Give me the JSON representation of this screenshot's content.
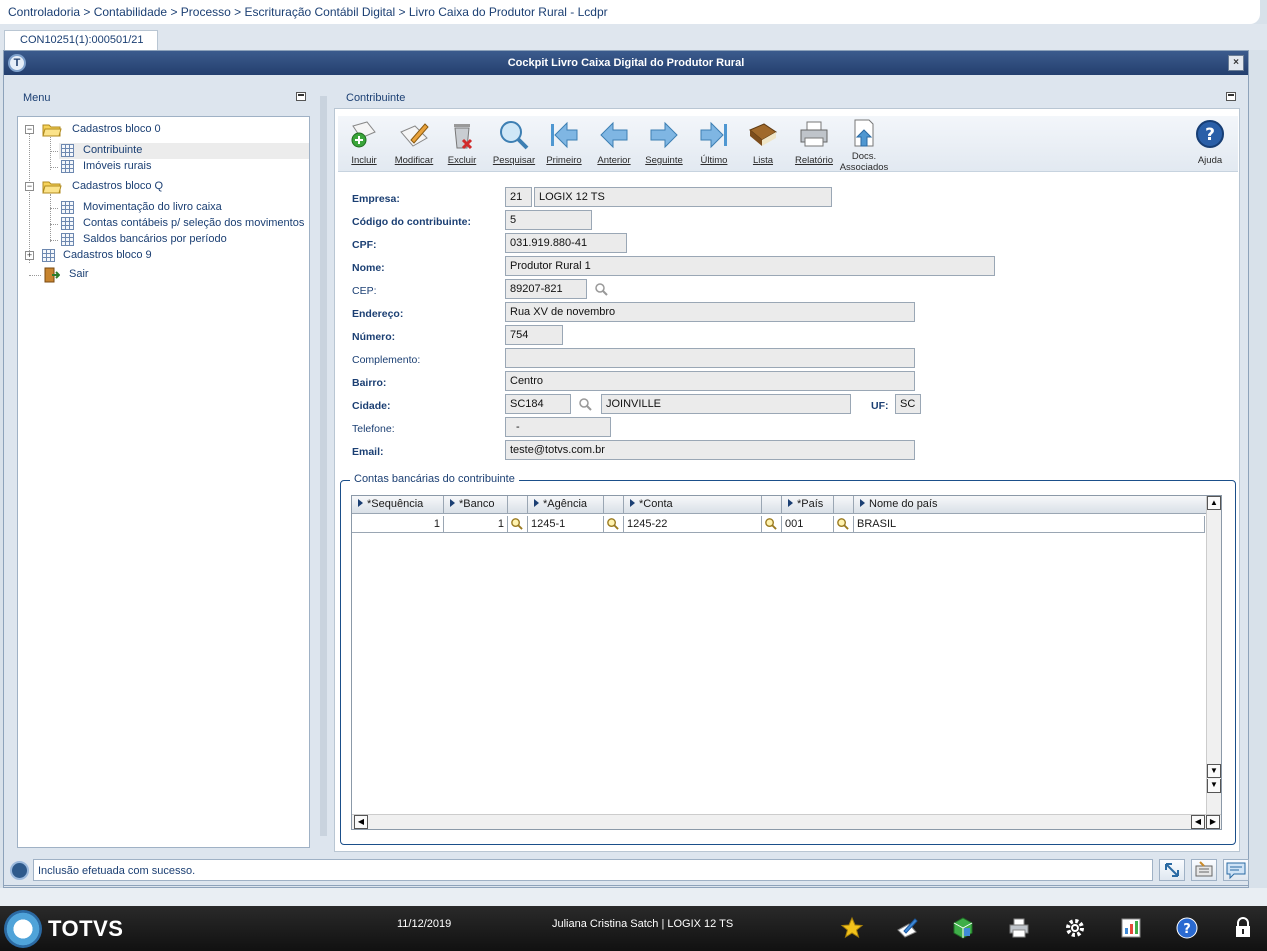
{
  "breadcrumb": "Controladoria > Contabilidade > Processo > Escrituração Contábil Digital > Livro Caixa do Produtor Rural - Lcdpr",
  "tab": "CON10251(1):000501/21",
  "window": {
    "title": "Cockpit Livro Caixa Digital do Produtor Rural",
    "close": "×"
  },
  "menu": {
    "title": "Menu",
    "items": [
      {
        "label": "Cadastros bloco 0"
      },
      {
        "label": "Contribuinte"
      },
      {
        "label": "Imóveis rurais"
      },
      {
        "label": "Cadastros bloco Q"
      },
      {
        "label": "Movimentação do livro caixa"
      },
      {
        "label": "Contas contábeis p/ seleção dos movimentos"
      },
      {
        "label": "Saldos bancários por período"
      },
      {
        "label": "Cadastros bloco 9"
      },
      {
        "label": "Sair"
      }
    ]
  },
  "content": {
    "title": "Contribuinte"
  },
  "toolbar": {
    "incluir": "Incluir",
    "modificar": "Modificar",
    "excluir": "Excluir",
    "pesquisar": "Pesquisar",
    "primeiro": "Primeiro",
    "anterior": "Anterior",
    "seguinte": "Seguinte",
    "ultimo": "Último",
    "lista": "Lista",
    "relatorio": "Relatório",
    "docs1": "Docs.",
    "docs2": "Associados",
    "ajuda": "Ajuda"
  },
  "form": {
    "empresa_label": "Empresa:",
    "empresa_code": "21",
    "empresa_name": "LOGIX 12 TS",
    "codigo_label": "Código do contribuinte:",
    "codigo": "5",
    "cpf_label": "CPF:",
    "cpf": "031.919.880-41",
    "nome_label": "Nome:",
    "nome": "Produtor Rural 1",
    "cep_label": "CEP:",
    "cep": "89207-821",
    "endereco_label": "Endereço:",
    "endereco": "Rua XV de novembro",
    "numero_label": "Número:",
    "numero": "754",
    "complemento_label": "Complemento:",
    "complemento": "",
    "bairro_label": "Bairro:",
    "bairro": "Centro",
    "cidade_label": "Cidade:",
    "cidade_code": "SC184",
    "cidade_name": "JOINVILLE",
    "uf_label": "UF:",
    "uf": "SC",
    "telefone_label": "Telefone:",
    "telefone": "-",
    "email_label": "Email:",
    "email": "teste@totvs.com.br"
  },
  "contas": {
    "title": "Contas bancárias do contribuinte",
    "columns": [
      "*Sequência",
      "*Banco",
      "*Agência",
      "*Conta",
      "*País",
      "Nome do país"
    ],
    "rows": [
      {
        "sequencia": "1",
        "banco": "1",
        "agencia": "1245-1",
        "conta": "1245-22",
        "pais": "001",
        "nome_pais": "BRASIL"
      }
    ]
  },
  "status": {
    "message": "Inclusão efetuada com sucesso."
  },
  "taskbar": {
    "brand": "TOTVS",
    "date": "11/12/2019",
    "user": "Juliana Cristina Satch | LOGIX 12 TS"
  }
}
